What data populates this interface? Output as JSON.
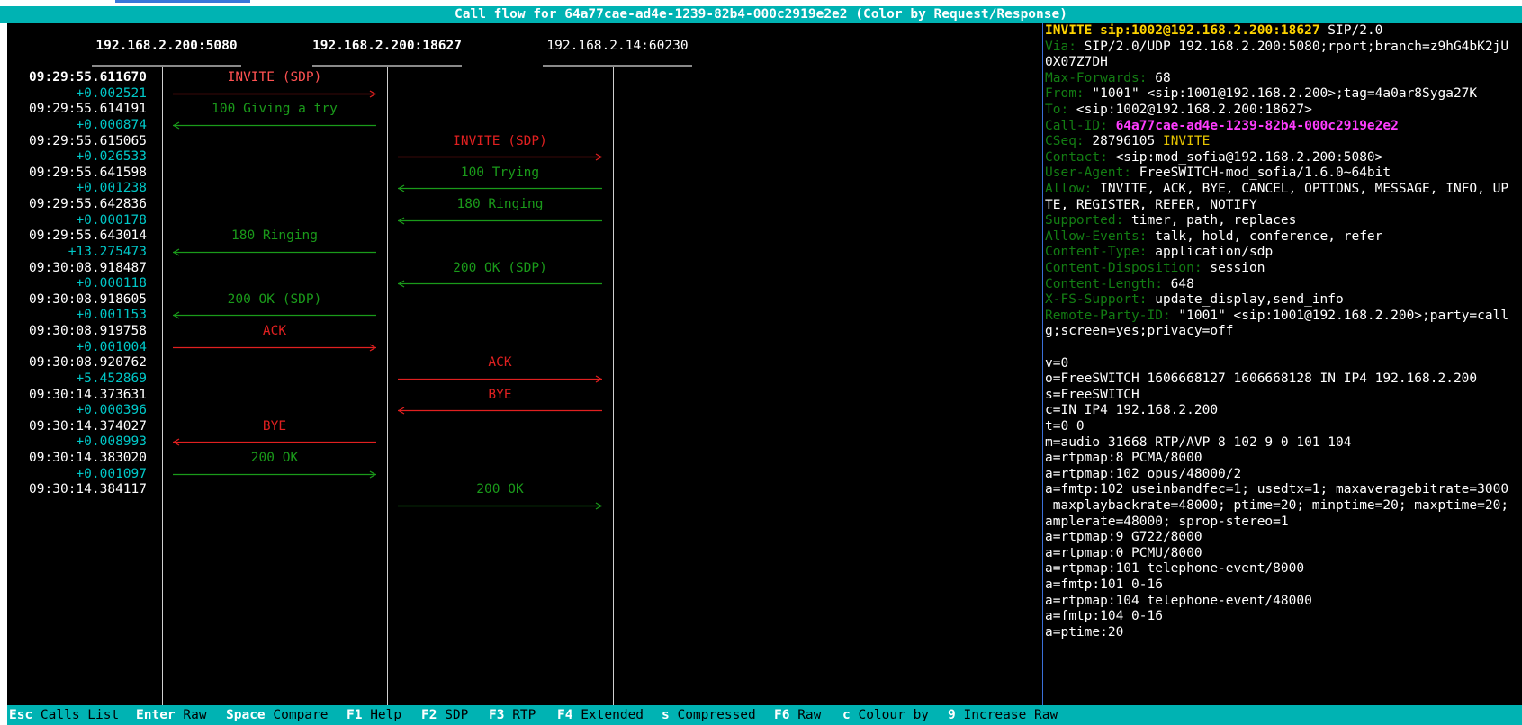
{
  "title": "Call flow for 64a77cae-ad4e-1239-82b4-000c2919e2e2 (Color by Request/Response)",
  "colors": {
    "titlebar": "#00b3b3",
    "request": "#e02020",
    "response": "#1a9a1a",
    "delta": "#00c8c8",
    "header_name": "#137d13",
    "callid_value": "#ff3dff",
    "request_line": "#ffd400"
  },
  "hosts": [
    {
      "label": "192.168.2.200:5080",
      "active": true
    },
    {
      "label": "192.168.2.200:18627",
      "active": true
    },
    {
      "label": "192.168.2.14:60230",
      "active": false
    }
  ],
  "messages": [
    {
      "time": "09:29:55.611670",
      "delta": "+0.002521",
      "label": "INVITE (SDP)",
      "from": 0,
      "to": 1,
      "kind": "request",
      "selected": true
    },
    {
      "time": "09:29:55.614191",
      "delta": "+0.000874",
      "label": "100 Giving a try",
      "from": 1,
      "to": 0,
      "kind": "response"
    },
    {
      "time": "09:29:55.615065",
      "delta": "+0.026533",
      "label": "INVITE (SDP)",
      "from": 1,
      "to": 2,
      "kind": "request"
    },
    {
      "time": "09:29:55.641598",
      "delta": "+0.001238",
      "label": "100 Trying",
      "from": 2,
      "to": 1,
      "kind": "response"
    },
    {
      "time": "09:29:55.642836",
      "delta": "+0.000178",
      "label": "180 Ringing",
      "from": 2,
      "to": 1,
      "kind": "response"
    },
    {
      "time": "09:29:55.643014",
      "delta": "+13.275473",
      "label": "180 Ringing",
      "from": 1,
      "to": 0,
      "kind": "response"
    },
    {
      "time": "09:30:08.918487",
      "delta": "+0.000118",
      "label": "200 OK (SDP)",
      "from": 2,
      "to": 1,
      "kind": "response"
    },
    {
      "time": "09:30:08.918605",
      "delta": "+0.001153",
      "label": "200 OK (SDP)",
      "from": 1,
      "to": 0,
      "kind": "response"
    },
    {
      "time": "09:30:08.919758",
      "delta": "+0.001004",
      "label": "ACK",
      "from": 0,
      "to": 1,
      "kind": "request"
    },
    {
      "time": "09:30:08.920762",
      "delta": "+5.452869",
      "label": "ACK",
      "from": 1,
      "to": 2,
      "kind": "request"
    },
    {
      "time": "09:30:14.373631",
      "delta": "+0.000396",
      "label": "BYE",
      "from": 2,
      "to": 1,
      "kind": "request"
    },
    {
      "time": "09:30:14.374027",
      "delta": "+0.008993",
      "label": "BYE",
      "from": 1,
      "to": 0,
      "kind": "request"
    },
    {
      "time": "09:30:14.383020",
      "delta": "+0.001097",
      "label": "200 OK",
      "from": 0,
      "to": 1,
      "kind": "response"
    },
    {
      "time": "09:30:14.384117",
      "delta": "",
      "label": "200 OK",
      "from": 1,
      "to": 2,
      "kind": "response"
    }
  ],
  "detail": {
    "request_line": {
      "method": "INVITE",
      "uri": "sip:1002@192.168.2.200:18627",
      "version": " SIP/2.0"
    },
    "headers": [
      {
        "name": "Via:",
        "value": " SIP/2.0/UDP 192.168.2.200:5080;rport;branch=z9hG4bK2jU"
      },
      {
        "name": "",
        "value": "0X07Z7DH"
      },
      {
        "name": "Max-Forwards:",
        "value": " 68"
      },
      {
        "name": "From:",
        "value": " \"1001\" <sip:1001@192.168.2.200>;tag=4a0ar8Syga27K"
      },
      {
        "name": "To:",
        "value": " <sip:1002@192.168.2.200:18627>"
      },
      {
        "name": "Call-ID:",
        "value": " 64a77cae-ad4e-1239-82b4-000c2919e2e2",
        "style": "callid"
      },
      {
        "name": "CSeq:",
        "value": " 28796105 ",
        "method": "INVITE"
      },
      {
        "name": "Contact:",
        "value": " <sip:mod_sofia@192.168.2.200:5080>"
      },
      {
        "name": "User-Agent:",
        "value": " FreeSWITCH-mod_sofia/1.6.0~64bit"
      },
      {
        "name": "Allow:",
        "value": " INVITE, ACK, BYE, CANCEL, OPTIONS, MESSAGE, INFO, UP"
      },
      {
        "name": "",
        "value": "TE, REGISTER, REFER, NOTIFY"
      },
      {
        "name": "Supported:",
        "value": " timer, path, replaces"
      },
      {
        "name": "Allow-Events:",
        "value": " talk, hold, conference, refer"
      },
      {
        "name": "Content-Type:",
        "value": " application/sdp"
      },
      {
        "name": "Content-Disposition:",
        "value": " session"
      },
      {
        "name": "Content-Length:",
        "value": " 648"
      },
      {
        "name": "X-FS-Support:",
        "value": " update_display,send_info"
      },
      {
        "name": "Remote-Party-ID:",
        "value": " \"1001\" <sip:1001@192.168.2.200>;party=call"
      },
      {
        "name": "",
        "value": "g;screen=yes;privacy=off"
      }
    ],
    "sdp": [
      "",
      "v=0",
      "o=FreeSWITCH 1606668127 1606668128 IN IP4 192.168.2.200",
      "s=FreeSWITCH",
      "c=IN IP4 192.168.2.200",
      "t=0 0",
      "m=audio 31668 RTP/AVP 8 102 9 0 101 104",
      "a=rtpmap:8 PCMA/8000",
      "a=rtpmap:102 opus/48000/2",
      "a=fmtp:102 useinbandfec=1; usedtx=1; maxaveragebitrate=3000",
      " maxplaybackrate=48000; ptime=20; minptime=20; maxptime=20;",
      "amplerate=48000; sprop-stereo=1",
      "a=rtpmap:9 G722/8000",
      "a=rtpmap:0 PCMU/8000",
      "a=rtpmap:101 telephone-event/8000",
      "a=fmtp:101 0-16",
      "a=rtpmap:104 telephone-event/48000",
      "a=fmtp:104 0-16",
      "a=ptime:20"
    ]
  },
  "shortcuts": [
    {
      "key": "Esc",
      "label": " Calls List"
    },
    {
      "key": "Enter",
      "label": " Raw"
    },
    {
      "key": "Space",
      "label": " Compare"
    },
    {
      "key": "F1",
      "label": " Help"
    },
    {
      "key": "F2",
      "label": " SDP"
    },
    {
      "key": "F3",
      "label": " RTP"
    },
    {
      "key": "F4",
      "label": " Extended"
    },
    {
      "key": "s",
      "label": " Compressed"
    },
    {
      "key": "F6",
      "label": " Raw"
    },
    {
      "key": "c",
      "label": " Colour by"
    },
    {
      "key": "9",
      "label": " Increase Raw"
    }
  ]
}
